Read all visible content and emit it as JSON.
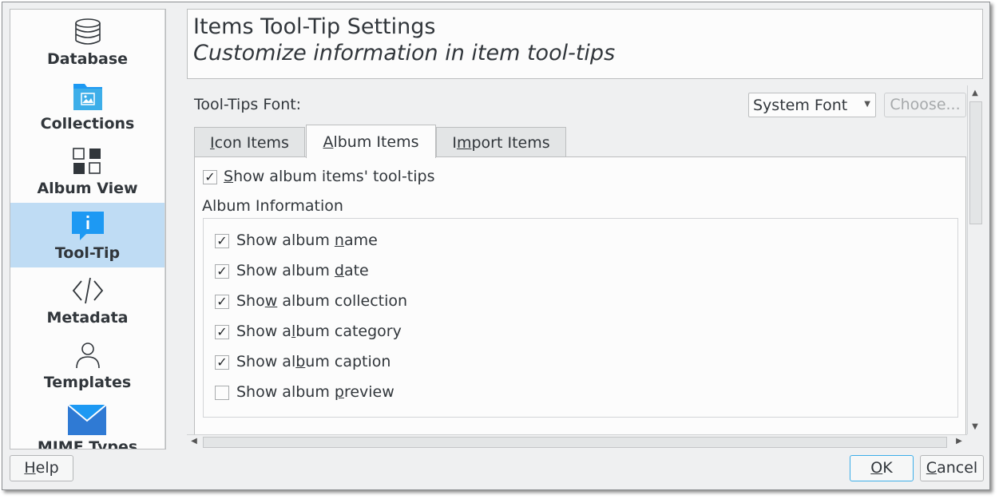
{
  "sidebar": {
    "items": [
      {
        "label": "Database",
        "icon": "database-icon"
      },
      {
        "label": "Collections",
        "icon": "folder-pictures-icon"
      },
      {
        "label": "Album View",
        "icon": "view-grid-icon"
      },
      {
        "label": "Tool-Tip",
        "icon": "tooltip-info-icon",
        "selected": true
      },
      {
        "label": "Metadata",
        "icon": "code-brackets-icon"
      },
      {
        "label": "Templates",
        "icon": "user-icon"
      },
      {
        "label": "MIME Types",
        "icon": "mail-envelope-icon"
      }
    ]
  },
  "header": {
    "title": "Items Tool-Tip Settings",
    "subtitle": "Customize information in item tool-tips"
  },
  "font": {
    "label": "Tool-Tips Font:",
    "selected": "System Font",
    "choose_button": "Choose..."
  },
  "tabs": [
    {
      "label": "Icon Items",
      "mnemonic_index": 0
    },
    {
      "label": "Album Items",
      "mnemonic_index": 0,
      "active": true
    },
    {
      "label": "Import Items",
      "mnemonic_index": 1
    }
  ],
  "album_tab": {
    "show_tooltips": {
      "label": "Show album items' tool-tips",
      "checked": true
    },
    "group_title": "Album Information",
    "options": [
      {
        "pre": "Show album ",
        "mn": "n",
        "post": "ame",
        "checked": true
      },
      {
        "pre": "Show album ",
        "mn": "d",
        "post": "ate",
        "checked": true
      },
      {
        "pre": "Sho",
        "mn": "w",
        "post": " album collection",
        "checked": true
      },
      {
        "pre": "Show a",
        "mn": "l",
        "post": "bum category",
        "checked": true
      },
      {
        "pre": "Show al",
        "mn": "b",
        "post": "um caption",
        "checked": true
      },
      {
        "pre": "Show album ",
        "mn": "p",
        "post": "review",
        "checked": false
      }
    ]
  },
  "footer": {
    "help_button": "Help",
    "ok_button": "OK",
    "cancel_button": "Cancel"
  },
  "colors": {
    "selection": "#bfdcf4",
    "accent": "#3daee9",
    "window_bg": "#eff0f1"
  }
}
